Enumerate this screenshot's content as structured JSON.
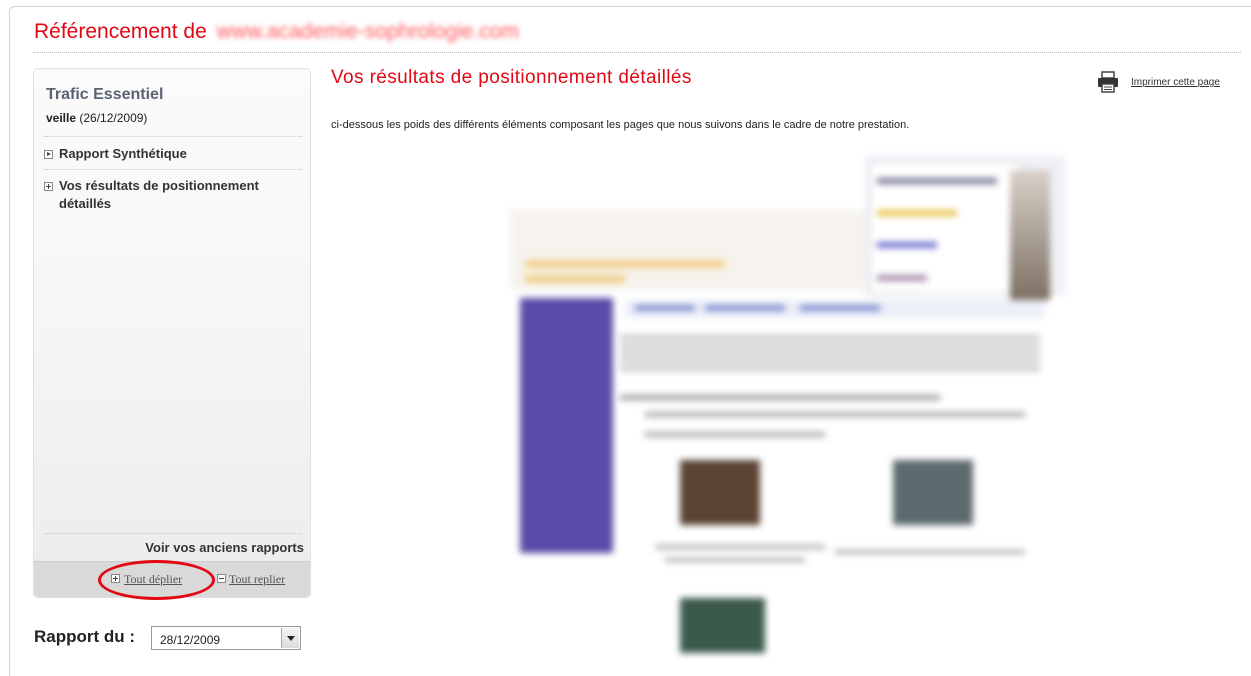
{
  "header": {
    "title_prefix": "Référencement de",
    "site": "www.academie-sophrologie.com"
  },
  "sidebar": {
    "title": "Trafic Essentiel",
    "veille_label": "veille",
    "veille_date": "(26/12/2009)",
    "items": [
      {
        "label": "Rapport Synthétique"
      },
      {
        "label": "Vos résultats de positionnement détaillés"
      }
    ],
    "old_reports": "Voir vos anciens rapports",
    "expand_all": "Tout déplier",
    "collapse_all": "Tout replier"
  },
  "rapport": {
    "label": "Rapport du :",
    "selected": "28/12/2009"
  },
  "main": {
    "title": "Vos résultats de positionnement détaillés",
    "print_label": "Imprimer cette page",
    "description": "ci-dessous les poids des différents éléments composant les pages que nous suivons dans le cadre de notre prestation."
  },
  "colors": {
    "accent": "#e30613",
    "purple": "#5b4aa8"
  }
}
